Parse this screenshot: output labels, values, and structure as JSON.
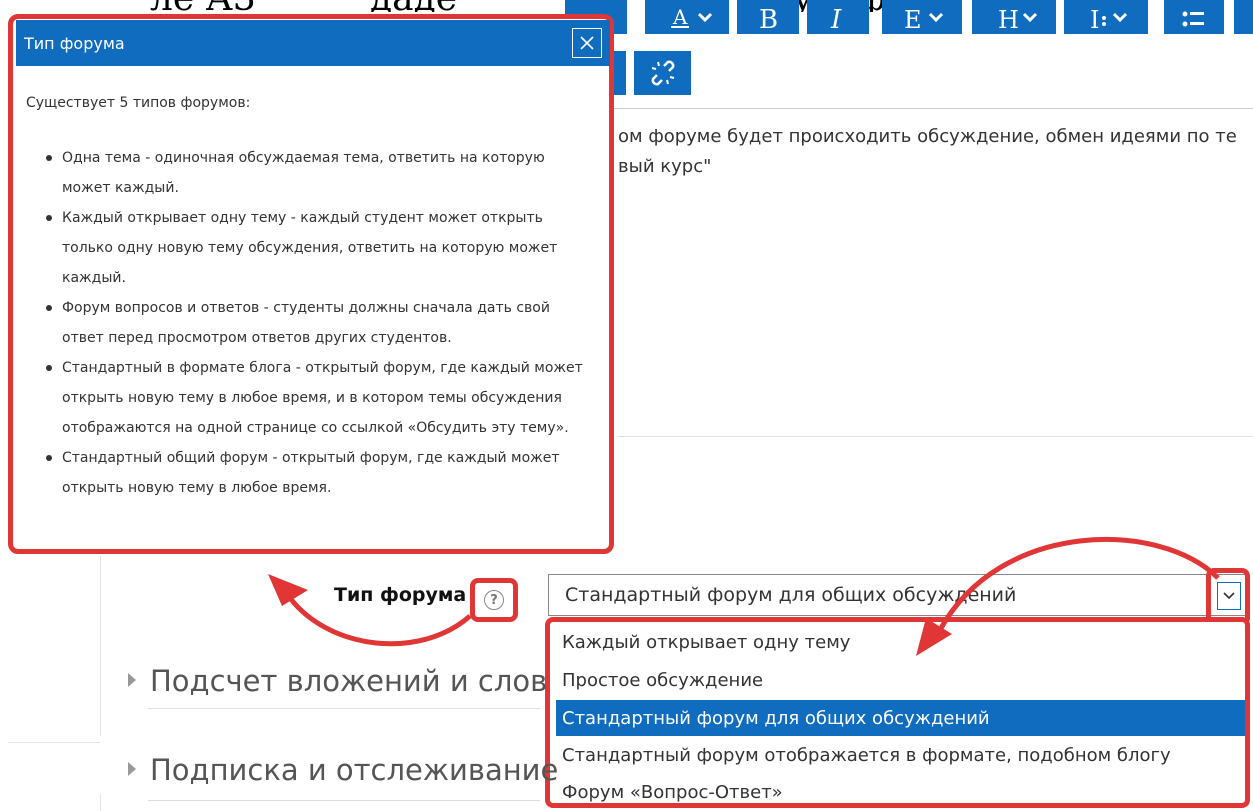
{
  "popup": {
    "title": "Тип форума",
    "intro": "Существует 5 типов форумов:",
    "items": [
      "Одна тема - одиночная обсуждаемая тема, ответить на которую может каждый.",
      "Каждый открывает одну тему - каждый студент может открыть только одну новую тему обсуждения, ответить на которую может каждый.",
      "Форум вопросов и ответов - студенты должны сначала дать свой ответ перед просмотром ответов других студентов.",
      "Стандартный в формате блога - открытый форум, где каждый может открыть новую тему в любое время, и в котором темы обсуждения отображаются на одной странице со ссылкой «Обсудить эту тему».",
      "Стандартный общий форум - открытый форум, где каждый может открыть новую тему в любое время."
    ]
  },
  "editor": {
    "desc_line1": "ом форуме будет происходить обсуждение, обмен идеями по те",
    "desc_line2": "вый курс\""
  },
  "form": {
    "forum_type_label": "Тип форума",
    "selected_value": "Стандартный форум для общих обсуждений",
    "options": [
      "Каждый открывает одну тему",
      "Простое обсуждение",
      "Стандартный форум для общих обсуждений",
      "Стандартный форум отображается в формате, подобном блогу",
      "Форум «Вопрос-Ответ»"
    ],
    "selected_index": 2
  },
  "sections": [
    "Подсчет вложений и слов",
    "Подписка и отслеживание"
  ],
  "colors": {
    "accent": "#0f6cbf",
    "highlight": "#e03636"
  }
}
